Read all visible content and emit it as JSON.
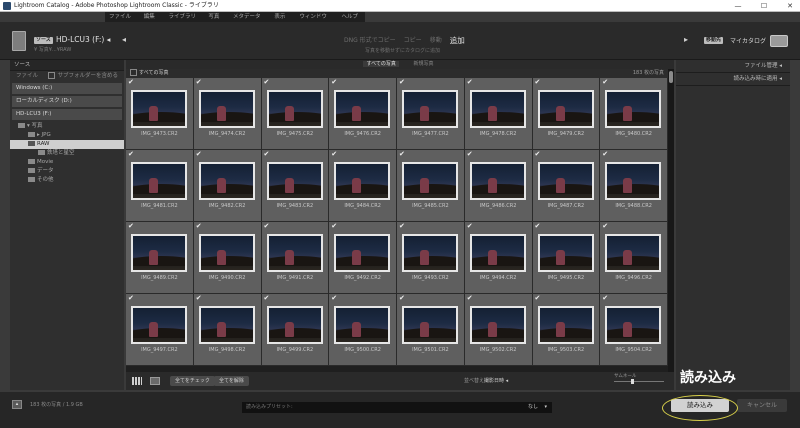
{
  "window": {
    "title": "Lightroom Catalog - Adobe Photoshop Lightroom Classic - ライブラリ",
    "controls": [
      "—",
      "☐",
      "✕"
    ]
  },
  "menubar": [
    "ファイル(F)",
    "編集(E)",
    "ライブラリ(L)",
    "写真(P)",
    "メタデータ(M)",
    "表示(V)",
    "ウィンドウ(W)",
    "ヘルプ(H)"
  ],
  "header": {
    "source_badge": "ソース",
    "source_name": "HD-LCU3 (F:) ◂",
    "source_path": "¥ 写真¥...¥RAW",
    "modes": [
      "DNG 形式でコピー",
      "コピー",
      "移動",
      "追加"
    ],
    "active_mode": "追加",
    "mode_description": "写真を移動せずにカタログに追加",
    "dest_badge": "移動先",
    "dest_name": "マイカタログ",
    "arrow_left": "◂",
    "arrow_right": "▸"
  },
  "left_panel": {
    "title": "ソース",
    "files_label": "ファイル",
    "subfolder_label": "サブフォルダーを含める",
    "volumes": [
      "Windows (C:)",
      "ローカルディスク (D:)",
      "HD-LCU3 (F:)"
    ],
    "tree": [
      {
        "label": "▾ 写真",
        "depth": 0,
        "selected": false
      },
      {
        "label": "▸ JPG",
        "depth": 1,
        "selected": false
      },
      {
        "label": "RAW",
        "depth": 1,
        "selected": true
      },
      {
        "label": "鉄塔と星空",
        "depth": 2,
        "selected": false
      },
      {
        "label": "Movie",
        "depth": 1,
        "selected": false
      },
      {
        "label": "データ",
        "depth": 1,
        "selected": false
      },
      {
        "label": "その他",
        "depth": 1,
        "selected": false
      }
    ]
  },
  "view_tabs": [
    "すべての写真",
    "新規写真"
  ],
  "active_view_tab": "すべての写真",
  "grid": {
    "header_label": "すべての写真",
    "count_label": "183 枚の写真",
    "photos": [
      "IMG_9473.CR2",
      "IMG_9474.CR2",
      "IMG_9475.CR2",
      "IMG_9476.CR2",
      "IMG_9477.CR2",
      "IMG_9478.CR2",
      "IMG_9479.CR2",
      "IMG_9480.CR2",
      "IMG_9481.CR2",
      "IMG_9482.CR2",
      "IMG_9483.CR2",
      "IMG_9484.CR2",
      "IMG_9485.CR2",
      "IMG_9486.CR2",
      "IMG_9487.CR2",
      "IMG_9488.CR2",
      "IMG_9489.CR2",
      "IMG_9490.CR2",
      "IMG_9491.CR2",
      "IMG_9492.CR2",
      "IMG_9493.CR2",
      "IMG_9494.CR2",
      "IMG_9495.CR2",
      "IMG_9496.CR2",
      "IMG_9497.CR2",
      "IMG_9498.CR2",
      "IMG_9499.CR2",
      "IMG_9500.CR2",
      "IMG_9501.CR2",
      "IMG_9502.CR2",
      "IMG_9503.CR2",
      "IMG_9504.CR2"
    ],
    "check_glyph": "✔"
  },
  "toolbar": {
    "check_all": "全てをチェック",
    "uncheck_all": "全てを解除",
    "sort_label": "並べ替え:",
    "sort_value": "撮影日時 ◂",
    "thumbnail_label": "サムネール"
  },
  "right_panel": {
    "items": [
      "ファイル管理 ◂",
      "読み込み時に適用 ◂"
    ]
  },
  "bottom": {
    "expand_glyph": "▴",
    "selection_info": "183 枚の写真 / 1.9 GB",
    "preset_label": "読み込みプリセット:",
    "preset_value": "なし",
    "preset_caret": "▾",
    "import_label": "読み込み",
    "cancel_label": "キャンセル"
  },
  "annotation": {
    "callout_text": "読み込み",
    "color": "#d8d04a"
  }
}
